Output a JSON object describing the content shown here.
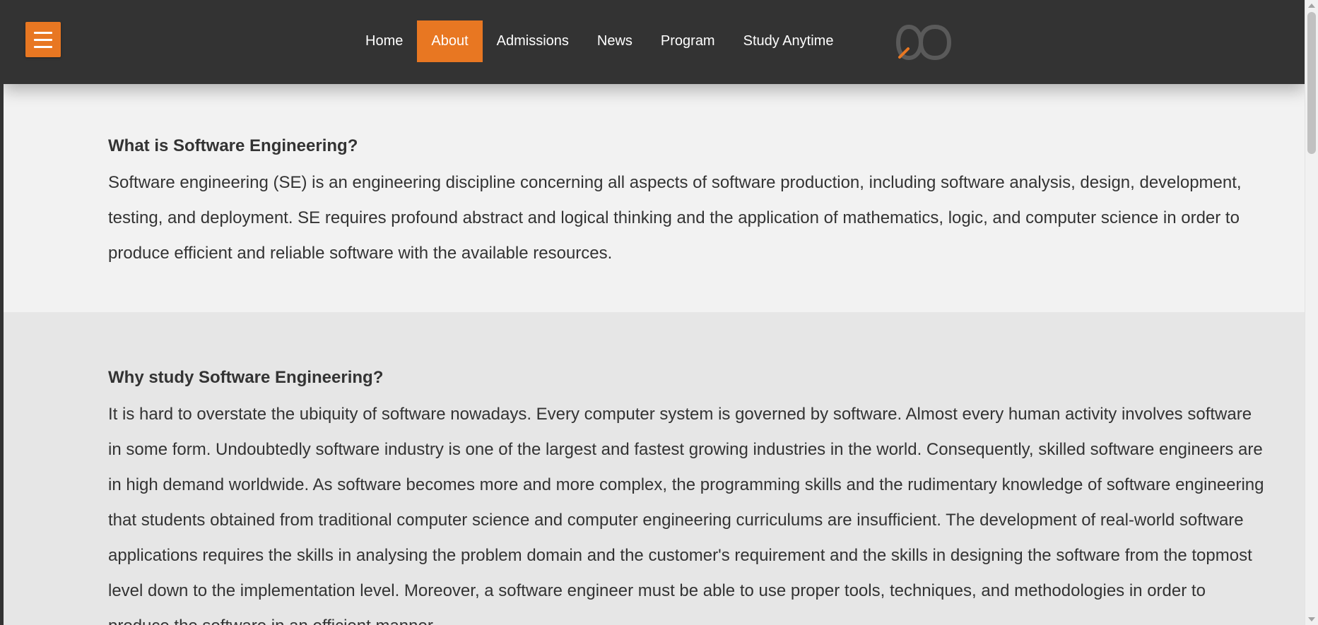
{
  "colors": {
    "accent": "#e87722",
    "navbar_background": "#333333",
    "section_light": "#f2f2f2",
    "section_gray": "#e6e6e6",
    "text": "#333333"
  },
  "navbar": {
    "menu_icon": "hamburger-menu-icon",
    "links": [
      {
        "label": "Home",
        "active": false
      },
      {
        "label": "About",
        "active": true
      },
      {
        "label": "Admissions",
        "active": false
      },
      {
        "label": "News",
        "active": false
      },
      {
        "label": "Program",
        "active": false
      },
      {
        "label": "Study Anytime",
        "active": false
      }
    ],
    "logo_icon": "infinity-logo-icon"
  },
  "sections": [
    {
      "heading": "What is Software Engineering?",
      "body": "Software engineering (SE) is an engineering discipline concerning all aspects of software production, including software analysis, design, development, testing, and deployment. SE requires profound abstract and logical thinking and the application of mathematics, logic, and computer science in order to produce efficient and reliable software with the available resources."
    },
    {
      "heading": "Why study Software Engineering?",
      "body": "It is hard to overstate the ubiquity of software nowadays. Every computer system is governed by software. Almost every human activity involves software in some form. Undoubtedly software industry is one of the largest and fastest growing industries in the world. Consequently, skilled software engineers are in high demand worldwide. As software becomes more and more complex, the programming skills and the rudimentary knowledge of software engineering that students obtained from traditional computer science and computer engineering curriculums are insufficient. The development of real-world software applications requires the skills in analysing the problem domain and the customer's requirement and the skills in designing the software from the topmost level down to the implementation level. Moreover, a software engineer must be able to use proper tools, techniques, and methodologies in order to produce the software in an efficient manner."
    }
  ]
}
